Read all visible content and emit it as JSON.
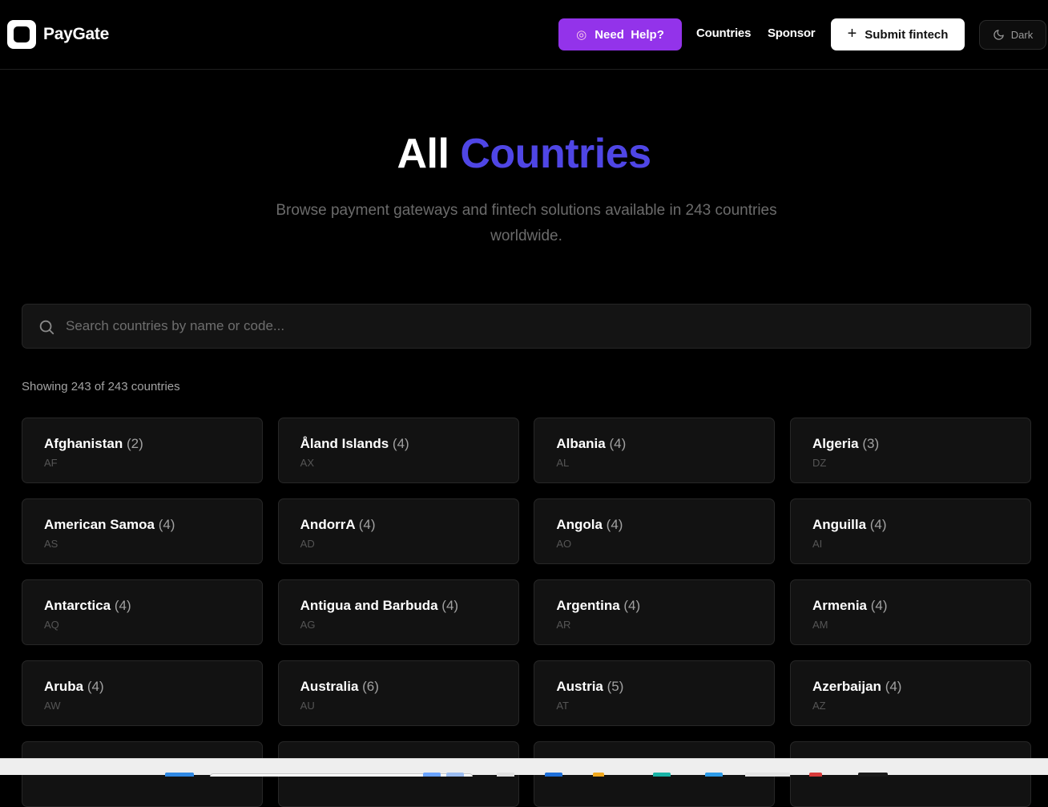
{
  "header": {
    "brand": "PayGate",
    "help_label": "Need  Help?",
    "nav": [
      "Countries",
      "Sponsor"
    ],
    "submit_label": "Submit fintech",
    "theme_label": "Dark"
  },
  "hero": {
    "title_plain": "All",
    "title_accent": "Countries",
    "subtitle": "Browse payment gateways and fintech solutions available in 243 countries worldwide."
  },
  "search": {
    "placeholder": "Search countries by name or code..."
  },
  "showing_text": "Showing 243 of 243 countries",
  "countries": [
    {
      "name": "Afghanistan",
      "count": "(2)",
      "code": "AF"
    },
    {
      "name": "Åland Islands",
      "count": "(4)",
      "code": "AX"
    },
    {
      "name": "Albania",
      "count": "(4)",
      "code": "AL"
    },
    {
      "name": "Algeria",
      "count": "(3)",
      "code": "DZ"
    },
    {
      "name": "American Samoa",
      "count": "(4)",
      "code": "AS"
    },
    {
      "name": "AndorrA",
      "count": "(4)",
      "code": "AD"
    },
    {
      "name": "Angola",
      "count": "(4)",
      "code": "AO"
    },
    {
      "name": "Anguilla",
      "count": "(4)",
      "code": "AI"
    },
    {
      "name": "Antarctica",
      "count": "(4)",
      "code": "AQ"
    },
    {
      "name": "Antigua and Barbuda",
      "count": "(4)",
      "code": "AG"
    },
    {
      "name": "Argentina",
      "count": "(4)",
      "code": "AR"
    },
    {
      "name": "Armenia",
      "count": "(4)",
      "code": "AM"
    },
    {
      "name": "Aruba",
      "count": "(4)",
      "code": "AW"
    },
    {
      "name": "Australia",
      "count": "(6)",
      "code": "AU"
    },
    {
      "name": "Austria",
      "count": "(5)",
      "code": "AT"
    },
    {
      "name": "Azerbaijan",
      "count": "(4)",
      "code": "AZ"
    },
    {
      "name": "",
      "count": "",
      "code": ""
    },
    {
      "name": "",
      "count": "",
      "code": ""
    },
    {
      "name": "",
      "count": "",
      "code": ""
    },
    {
      "name": "",
      "count": "",
      "code": ""
    }
  ],
  "colors": {
    "accent": "#4f46e5",
    "help_button": "#9333ea",
    "background": "#000000",
    "card": "#121212"
  }
}
